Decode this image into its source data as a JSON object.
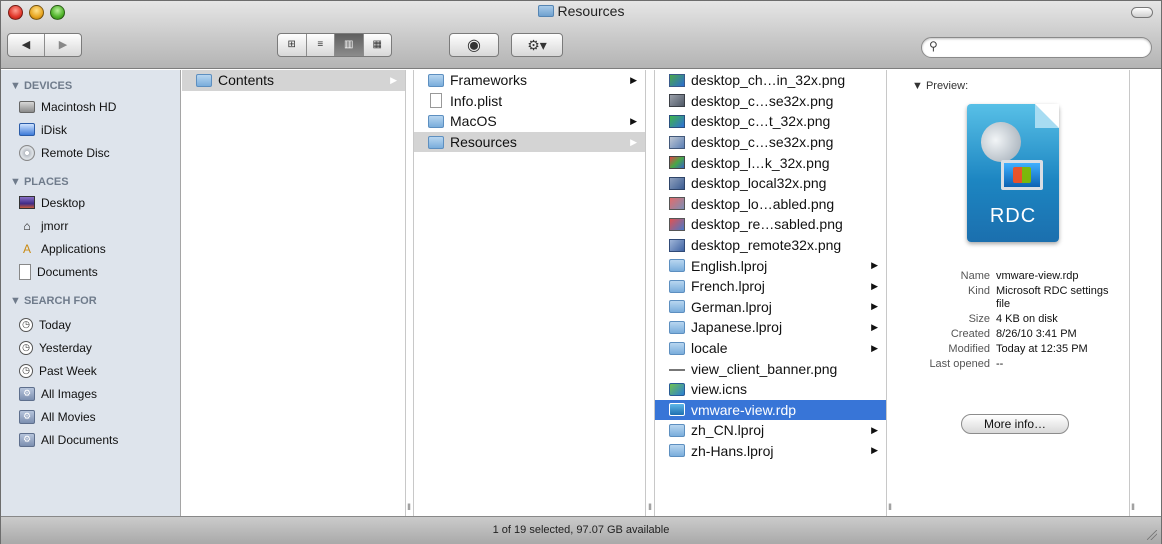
{
  "window": {
    "title": "Resources",
    "status": "1 of 19 selected, 97.07 GB available"
  },
  "toolbar": {
    "back_label": "◀",
    "forward_label": "▶",
    "view_icons_label": "⊞",
    "view_list_label": "≡",
    "view_columns_label": "▥",
    "view_coverflow_label": "▦",
    "quicklook_label": "◉",
    "action_label": "⚙▾",
    "search_placeholder": ""
  },
  "sidebar": {
    "devices_heading": "▼ DEVICES",
    "places_heading": "▼ PLACES",
    "search_heading": "▼ SEARCH FOR",
    "devices": [
      {
        "label": "Macintosh HD",
        "icon": "hard-drive-icon"
      },
      {
        "label": "iDisk",
        "icon": "idisk-icon"
      },
      {
        "label": "Remote Disc",
        "icon": "disc-icon"
      }
    ],
    "places": [
      {
        "label": "Desktop",
        "icon": "desktop-icon"
      },
      {
        "label": "jmorr",
        "icon": "home-icon"
      },
      {
        "label": "Applications",
        "icon": "applications-icon"
      },
      {
        "label": "Documents",
        "icon": "documents-icon"
      }
    ],
    "search": [
      {
        "label": "Today",
        "icon": "clock-icon"
      },
      {
        "label": "Yesterday",
        "icon": "clock-icon"
      },
      {
        "label": "Past Week",
        "icon": "clock-icon"
      },
      {
        "label": "All Images",
        "icon": "smart-folder-icon"
      },
      {
        "label": "All Movies",
        "icon": "smart-folder-icon"
      },
      {
        "label": "All Documents",
        "icon": "smart-folder-icon"
      }
    ]
  },
  "columns": {
    "c1": [
      {
        "label": "Contents",
        "kind": "folder",
        "arrow": true,
        "selected": "gray"
      }
    ],
    "c2": [
      {
        "label": "Frameworks",
        "kind": "folder",
        "arrow": true
      },
      {
        "label": "Info.plist",
        "kind": "plist",
        "arrow": false
      },
      {
        "label": "MacOS",
        "kind": "folder",
        "arrow": true
      },
      {
        "label": "Resources",
        "kind": "folder",
        "arrow": true,
        "selected": "gray"
      }
    ],
    "c3": [
      {
        "label": "desktop_ch…in_32x.png",
        "kind": "png1"
      },
      {
        "label": "desktop_c…se32x.png",
        "kind": "png2"
      },
      {
        "label": "desktop_c…t_32x.png",
        "kind": "png3"
      },
      {
        "label": "desktop_c…se32x.png",
        "kind": "png4"
      },
      {
        "label": "desktop_l…k_32x.png",
        "kind": "png5"
      },
      {
        "label": "desktop_local32x.png",
        "kind": "png6"
      },
      {
        "label": "desktop_lo…abled.png",
        "kind": "png7"
      },
      {
        "label": "desktop_re…sabled.png",
        "kind": "png8"
      },
      {
        "label": "desktop_remote32x.png",
        "kind": "png9"
      },
      {
        "label": "English.lproj",
        "kind": "folder",
        "arrow": true
      },
      {
        "label": "French.lproj",
        "kind": "folder",
        "arrow": true
      },
      {
        "label": "German.lproj",
        "kind": "folder",
        "arrow": true
      },
      {
        "label": "Japanese.lproj",
        "kind": "folder",
        "arrow": true
      },
      {
        "label": "locale",
        "kind": "folder",
        "arrow": true
      },
      {
        "label": "view_client_banner.png",
        "kind": "line"
      },
      {
        "label": "view.icns",
        "kind": "icns"
      },
      {
        "label": "vmware-view.rdp",
        "kind": "rdp",
        "selected": "blue"
      },
      {
        "label": "zh_CN.lproj",
        "kind": "folder",
        "arrow": true
      },
      {
        "label": "zh-Hans.lproj",
        "kind": "folder",
        "arrow": true
      }
    ]
  },
  "preview": {
    "heading": "▼ Preview:",
    "icon_text": "RDC",
    "info": [
      {
        "key": "Name",
        "value": "vmware-view.rdp"
      },
      {
        "key": "Kind",
        "value": "Microsoft RDC settings file"
      },
      {
        "key": "Size",
        "value": "4 KB on disk"
      },
      {
        "key": "Created",
        "value": "8/26/10 3:41 PM"
      },
      {
        "key": "Modified",
        "value": "Today at 12:35 PM"
      },
      {
        "key": "Last opened",
        "value": "--"
      }
    ],
    "more_info_label": "More info…"
  }
}
